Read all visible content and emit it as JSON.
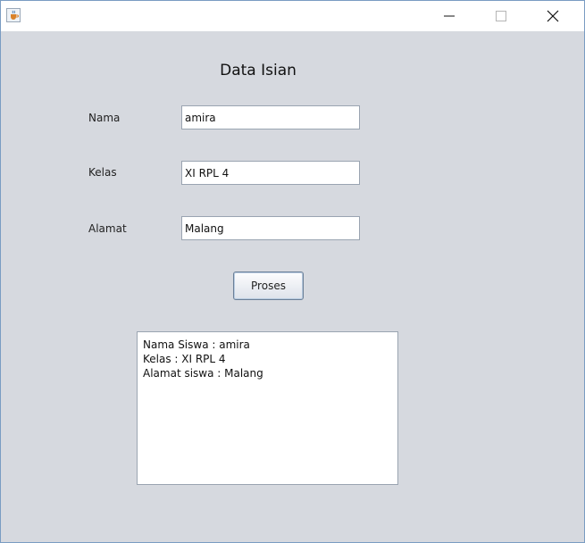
{
  "window": {
    "icon": "java-cup-icon",
    "controls": {
      "minimize": "minimize-icon",
      "maximize": "maximize-icon",
      "close": "close-icon"
    }
  },
  "form": {
    "title": "Data Isian",
    "fields": [
      {
        "label": "Nama",
        "value": "amira"
      },
      {
        "label": "Kelas",
        "value": "XI RPL 4"
      },
      {
        "label": "Alamat",
        "value": "Malang"
      }
    ],
    "submit_label": "Proses"
  },
  "output": {
    "lines": [
      "Nama Siswa : amira",
      "Kelas : XI RPL 4",
      "Alamat siswa : Malang"
    ]
  }
}
